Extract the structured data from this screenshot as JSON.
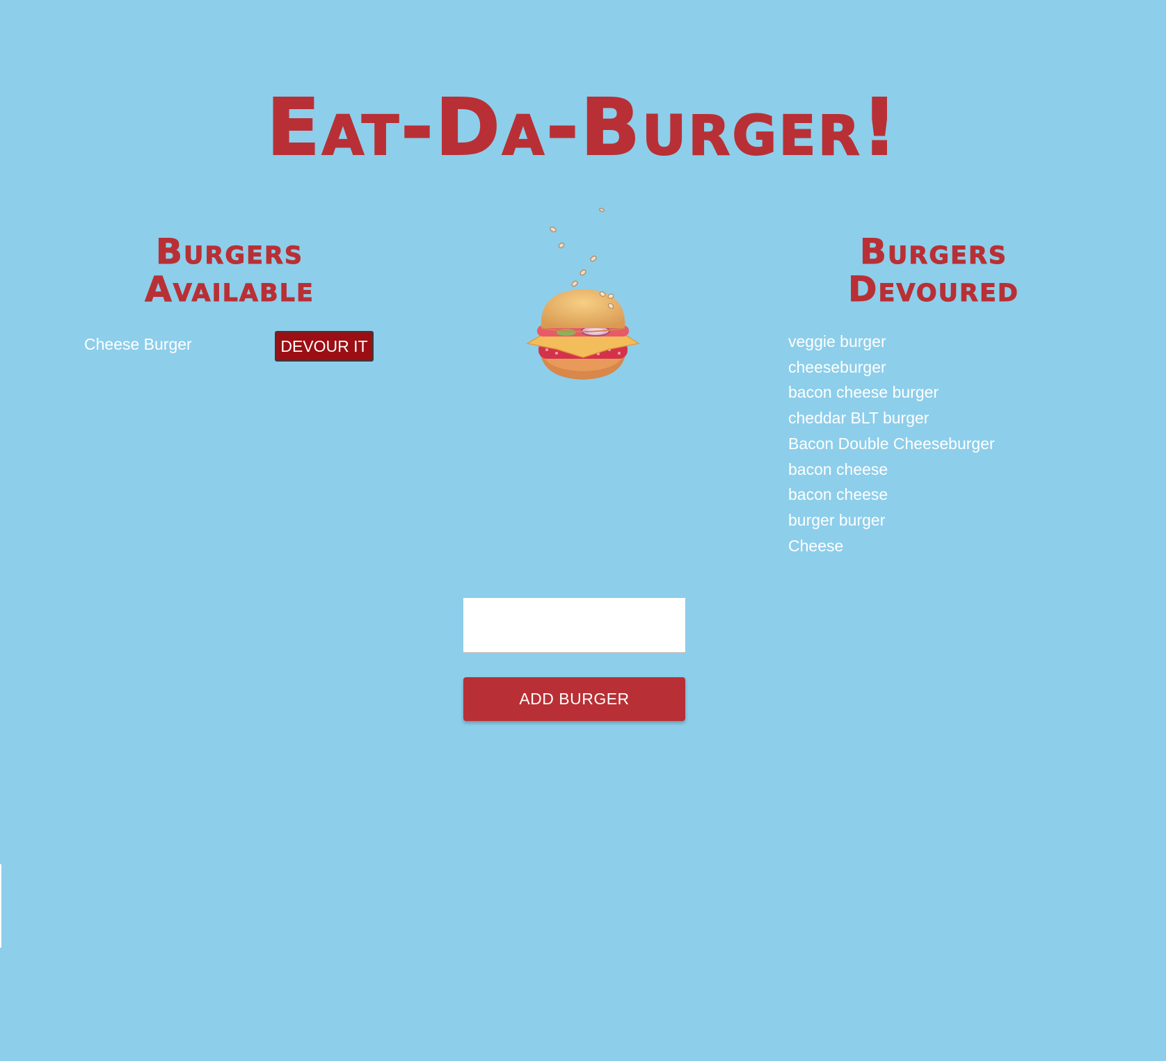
{
  "header": {
    "title": "Eat-Da-Burger!"
  },
  "available": {
    "heading": "Burgers Available",
    "items": [
      {
        "name": "Cheese Burger",
        "action_label": "DEVOUR IT"
      }
    ]
  },
  "devoured": {
    "heading": "Burgers Devoured",
    "items": [
      "veggie burger",
      "cheeseburger",
      "bacon cheese burger",
      "cheddar BLT burger",
      "Bacon Double Cheeseburger",
      "bacon cheese",
      "bacon cheese",
      "burger burger",
      "Cheese"
    ]
  },
  "form": {
    "input_value": "",
    "submit_label": "ADD BURGER"
  },
  "colors": {
    "background": "#8dceea",
    "accent": "#b83035",
    "devour_button": "#9b0f14"
  },
  "icons": {
    "illustration": "burger-icon"
  }
}
